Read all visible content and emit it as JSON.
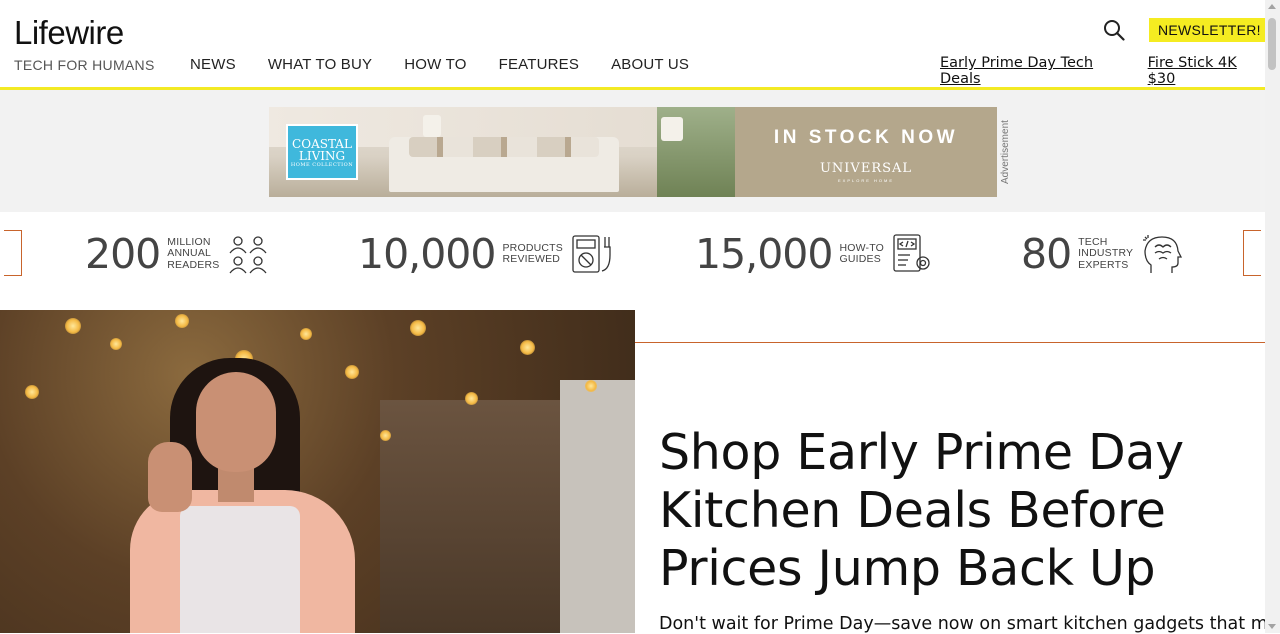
{
  "site": {
    "logo": "Lifewire",
    "tagline": "TECH FOR HUMANS"
  },
  "nav": [
    {
      "label": "NEWS"
    },
    {
      "label": "WHAT TO BUY"
    },
    {
      "label": "HOW TO"
    },
    {
      "label": "FEATURES"
    },
    {
      "label": "ABOUT US"
    }
  ],
  "header_actions": {
    "search_icon": "search-icon",
    "newsletter_label": "NEWSLETTER!"
  },
  "quick_links": [
    {
      "label": "Early Prime Day Tech Deals"
    },
    {
      "label": "Fire Stick 4K $30"
    }
  ],
  "ad": {
    "brand_line1": "COASTAL",
    "brand_line2": "LIVING",
    "brand_small": "HOME COLLECTION",
    "cta": "IN STOCK NOW",
    "maker": "UNIVERSAL",
    "maker_tagline": "EXPLORE HOME",
    "label": "Advertisement"
  },
  "stats": [
    {
      "value": "200",
      "label_lines": [
        "MILLION",
        "ANNUAL",
        "READERS"
      ],
      "icon": "readers-icon"
    },
    {
      "value": "10,000",
      "label_lines": [
        "PRODUCTS",
        "REVIEWED"
      ],
      "icon": "multimeter-icon"
    },
    {
      "value": "15,000",
      "label_lines": [
        "HOW-TO",
        "GUIDES"
      ],
      "icon": "code-guide-icon"
    },
    {
      "value": "80",
      "label_lines": [
        "TECH",
        "INDUSTRY",
        "EXPERTS"
      ],
      "icon": "brain-head-icon"
    }
  ],
  "hero": {
    "headline": "Shop Early Prime Day Kitchen Deals Before Prices Jump Back Up",
    "dek": "Don't wait for Prime Day—save now on smart kitchen gadgets that make"
  },
  "colors": {
    "accent_yellow": "#f5ec21",
    "accent_orange": "#c8642c"
  }
}
